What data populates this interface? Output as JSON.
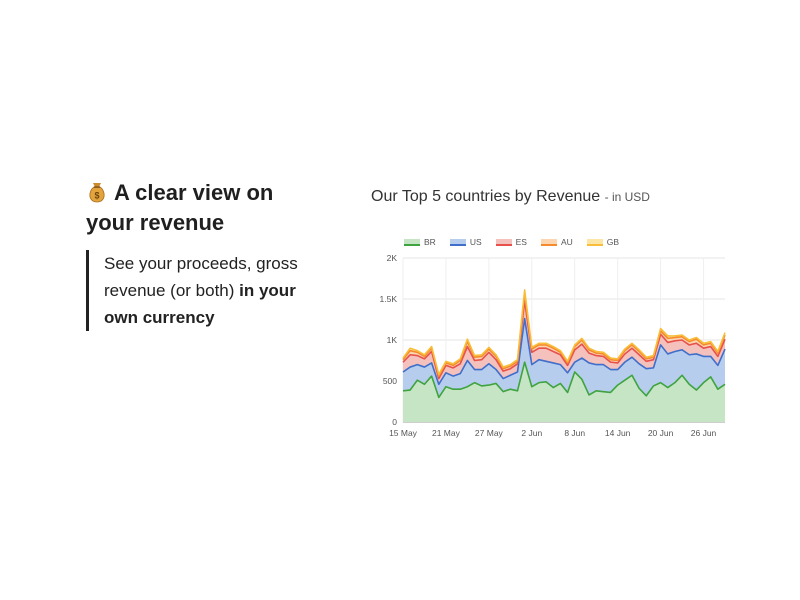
{
  "feature": {
    "icon": "money-bag-icon",
    "headline": "A clear view on your revenue",
    "body_prefix": "See your proceeds, gross revenue (or both) ",
    "body_bold": "in your own currency"
  },
  "chart_data": {
    "type": "area",
    "stacked": true,
    "title": "Our Top 5 countries by Revenue",
    "subtitle": "- in USD",
    "xlabel": "",
    "ylabel": "",
    "ylim": [
      0,
      2000
    ],
    "y_ticks": [
      "0",
      "500",
      "1K",
      "1.5K",
      "2K"
    ],
    "y_tick_values": [
      0,
      500,
      1000,
      1500,
      2000
    ],
    "x_ticks": [
      "15 May",
      "21 May",
      "27 May",
      "2 Jun",
      "8 Jun",
      "14 Jun",
      "20 Jun",
      "26 Jun"
    ],
    "x_tick_index": [
      0,
      6,
      12,
      18,
      24,
      30,
      36,
      42
    ],
    "grid": true,
    "legend_position": "top-left",
    "series": [
      {
        "name": "BR",
        "color": "#3fa33f",
        "fill": "#c6e5c4",
        "values": [
          380,
          390,
          510,
          460,
          560,
          300,
          430,
          400,
          400,
          430,
          480,
          440,
          450,
          470,
          370,
          400,
          380,
          730,
          430,
          480,
          490,
          420,
          470,
          360,
          610,
          520,
          330,
          380,
          370,
          360,
          450,
          510,
          570,
          410,
          320,
          440,
          480,
          420,
          480,
          570,
          460,
          390,
          480,
          550,
          400,
          460
        ]
      },
      {
        "name": "US",
        "color": "#3f6fcb",
        "fill": "#b6cdee",
        "values": [
          230,
          280,
          190,
          210,
          160,
          160,
          170,
          160,
          190,
          320,
          160,
          200,
          260,
          170,
          160,
          170,
          230,
          530,
          270,
          280,
          250,
          300,
          230,
          240,
          120,
          260,
          390,
          320,
          330,
          280,
          190,
          220,
          220,
          300,
          330,
          220,
          460,
          410,
          380,
          310,
          360,
          440,
          320,
          250,
          290,
          430
        ]
      },
      {
        "name": "ES",
        "color": "#e8504b",
        "fill": "#f4c1bd",
        "values": [
          120,
          150,
          110,
          100,
          140,
          70,
          90,
          100,
          120,
          170,
          110,
          120,
          140,
          120,
          90,
          80,
          100,
          220,
          150,
          140,
          160,
          140,
          120,
          90,
          150,
          170,
          120,
          110,
          100,
          90,
          80,
          100,
          110,
          110,
          90,
          100,
          130,
          140,
          130,
          120,
          120,
          130,
          100,
          120,
          110,
          120
        ]
      },
      {
        "name": "AU",
        "color": "#f58a2e",
        "fill": "#fbd6b1",
        "values": [
          30,
          50,
          40,
          30,
          40,
          30,
          30,
          30,
          40,
          60,
          40,
          40,
          40,
          40,
          30,
          30,
          30,
          90,
          40,
          40,
          40,
          40,
          30,
          30,
          40,
          50,
          40,
          30,
          30,
          30,
          30,
          40,
          40,
          40,
          30,
          30,
          40,
          50,
          40,
          40,
          40,
          50,
          40,
          40,
          40,
          50
        ]
      },
      {
        "name": "GB",
        "color": "#f8be3a",
        "fill": "#fbe6a6",
        "values": [
          20,
          30,
          20,
          20,
          20,
          20,
          20,
          20,
          20,
          30,
          20,
          20,
          20,
          20,
          20,
          20,
          20,
          40,
          20,
          20,
          20,
          20,
          20,
          20,
          20,
          20,
          20,
          20,
          20,
          20,
          20,
          20,
          20,
          20,
          20,
          20,
          30,
          30,
          20,
          20,
          20,
          20,
          20,
          20,
          20,
          30
        ]
      }
    ]
  }
}
